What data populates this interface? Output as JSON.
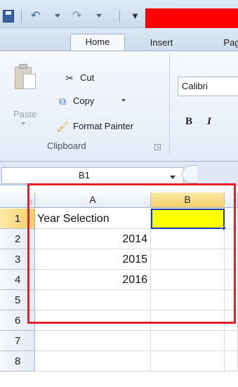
{
  "ribbon": {
    "tabs": [
      "Home",
      "Insert",
      "Pag"
    ],
    "clipboard": {
      "paste_label": "Paste",
      "cut_label": "Cut",
      "copy_label": "Copy",
      "format_painter_label": "Format Painter",
      "group_label": "Clipboard"
    },
    "font": {
      "name": "Calibri",
      "bold_label": "B",
      "italic_label": "I"
    }
  },
  "formula_bar": {
    "name_box": "B1"
  },
  "sheet": {
    "columns": [
      "A",
      "B"
    ],
    "rows": [
      {
        "num": "1",
        "a": "Year Selection",
        "b": ""
      },
      {
        "num": "2",
        "a": "2014",
        "b": ""
      },
      {
        "num": "3",
        "a": "2015",
        "b": ""
      },
      {
        "num": "4",
        "a": "2016",
        "b": ""
      },
      {
        "num": "5",
        "a": "",
        "b": ""
      },
      {
        "num": "6",
        "a": "",
        "b": ""
      },
      {
        "num": "7",
        "a": "",
        "b": ""
      },
      {
        "num": "8",
        "a": "",
        "b": ""
      }
    ],
    "selected_cell": "B1",
    "selected_fill": "#ffff00",
    "highlight_outline": "#e3212b"
  },
  "icons": {
    "save": "save-icon",
    "undo": "undo-icon",
    "redo": "redo-icon",
    "customize": "customize-qat-icon",
    "paste": "paste-clipboard-icon",
    "cut": "scissors-icon",
    "copy": "copy-icon",
    "format_painter": "paintbrush-icon"
  }
}
